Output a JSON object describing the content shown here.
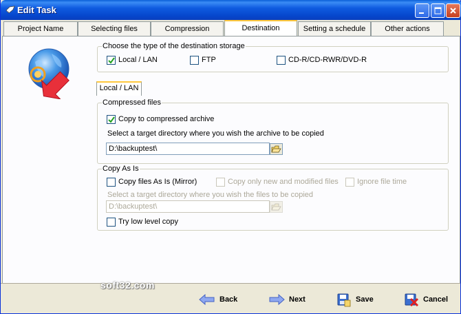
{
  "window": {
    "title": "Edit Task"
  },
  "tabs": [
    {
      "label": "Project Name"
    },
    {
      "label": "Selecting files"
    },
    {
      "label": "Compression"
    },
    {
      "label": "Destination"
    },
    {
      "label": "Setting a schedule"
    },
    {
      "label": "Other actions"
    }
  ],
  "destination_type": {
    "title": "Choose the type of the destination storage",
    "options": [
      {
        "label": "Local / LAN",
        "checked": true
      },
      {
        "label": "FTP",
        "checked": false
      },
      {
        "label": "CD-R/CD-RWR/DVD-R",
        "checked": false
      }
    ]
  },
  "subtab": {
    "label": "Local / LAN"
  },
  "compressed": {
    "title": "Compressed files",
    "copy_label": "Copy to compressed archive",
    "copy_checked": true,
    "instruction": "Select a target directory where you wish the archive to be copied",
    "path": "D:\\backuptest\\"
  },
  "copy_as_is": {
    "title": "Copy As Is",
    "mirror_label": "Copy files As Is (Mirror)",
    "new_modified_label": "Copy only new and modified files",
    "ignore_time_label": "Ignore file time",
    "instruction": "Select a target directory where you wish the files to be copied",
    "path": "D:\\backuptest\\",
    "low_level_label": "Try low level copy"
  },
  "watermark": "soft32.com",
  "buttons": {
    "back": "Back",
    "next": "Next",
    "save": "Save",
    "cancel": "Cancel"
  },
  "icons": [
    "app-icon",
    "globe-icon",
    "browse-folder-icon",
    "back-arrow-icon",
    "next-arrow-icon",
    "save-icon",
    "cancel-icon"
  ],
  "colors": {
    "title_bar": "#0a5fd8",
    "active_tab_accent": "#ffc83c",
    "face": "#ece9d8"
  }
}
